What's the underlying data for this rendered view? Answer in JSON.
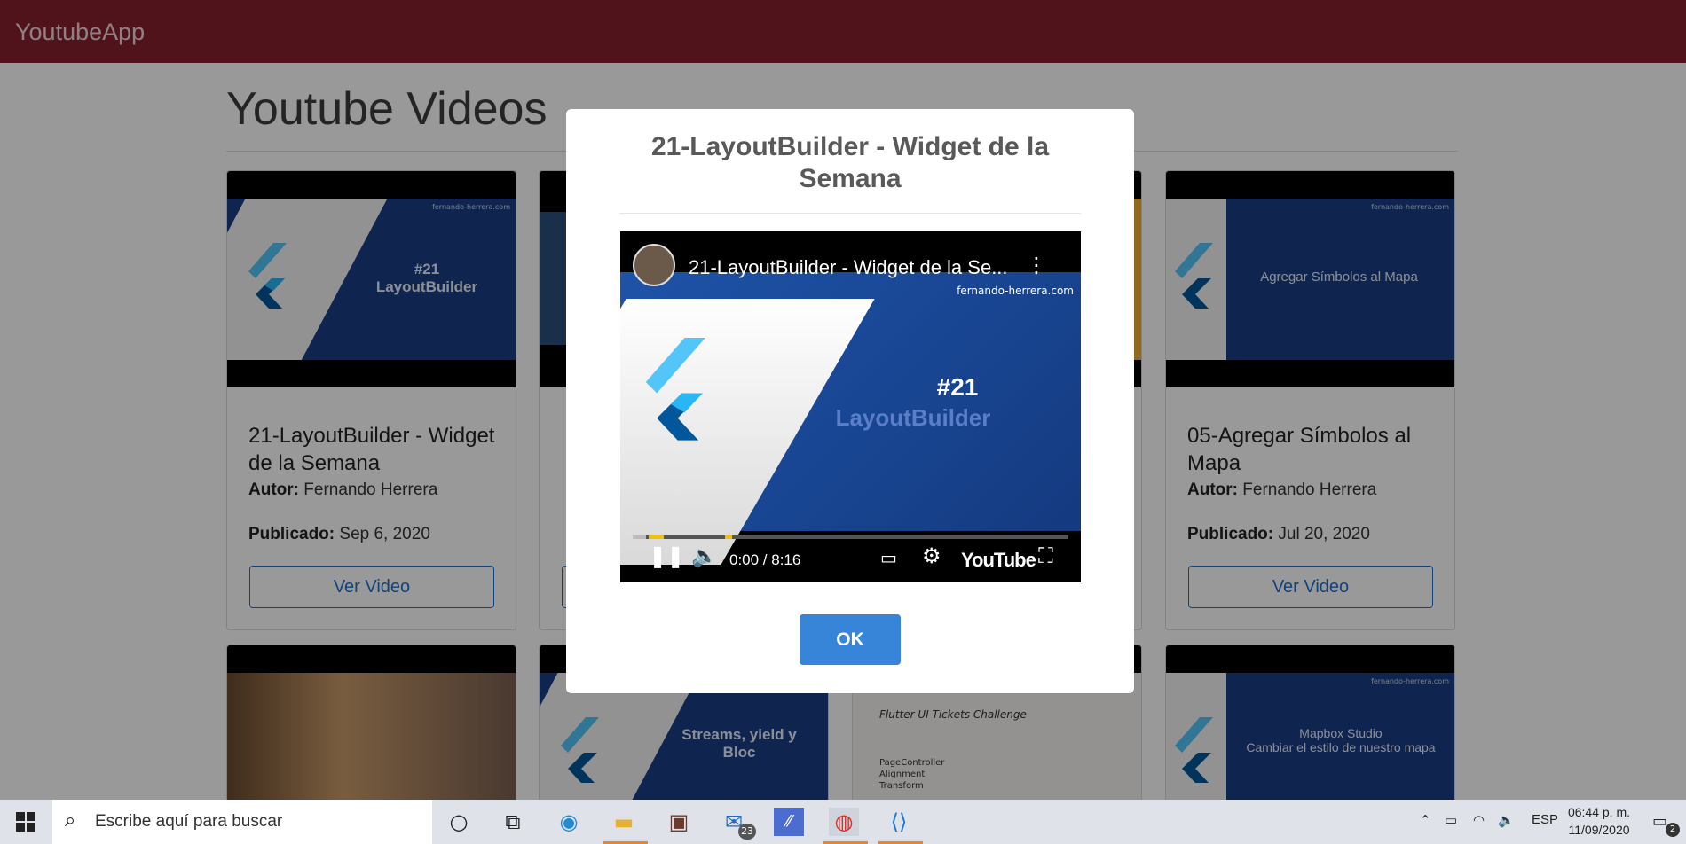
{
  "app": {
    "brand": "YoutubeApp"
  },
  "page": {
    "title": "Youtube Videos"
  },
  "cards": [
    {
      "slide_text": "#21\nLayoutBuilder",
      "slide_url": "fernando-herrera.com",
      "title": "21-LayoutBuilder - Widget de la Semana",
      "author_label": "Autor:",
      "author": "Fernando Herrera",
      "published_label": "Publicado:",
      "published": "Sep 6, 2020",
      "button": "Ver Video"
    },
    {
      "slide_text": "Agregar Símbolos al Mapa",
      "slide_url": "fernando-herrera.com",
      "title": "05-Agregar Símbolos al Mapa",
      "author_label": "Autor:",
      "author": "Fernando Herrera",
      "published_label": "Publicado:",
      "published": "Jul 20, 2020",
      "button": "Ver Video"
    }
  ],
  "row2": [
    {
      "slide_text": "Streams, yield y Bloc"
    },
    {
      "slide_text": "Flutter UI Tickets Challenge",
      "bullets": [
        "PageController",
        "Alignment",
        "Transform"
      ]
    },
    {
      "slide_text": "Mapbox Studio\nCambiar el estilo de nuestro mapa",
      "slide_url": "fernando-herrera.com"
    }
  ],
  "modal": {
    "title": "21-LayoutBuilder - Widget de la Semana",
    "video_title": "21-LayoutBuilder - Widget de la Se...",
    "video_url": "fernando-herrera.com",
    "video_big": "#21",
    "video_big2": "LayoutBuilder",
    "time": "0:00 / 8:16",
    "youtube_logo": "YouTube",
    "ok_label": "OK"
  },
  "taskbar": {
    "search_placeholder": "Escribe aquí para buscar",
    "mail_badge": "23",
    "lang": "ESP",
    "time": "06:44 p. m.",
    "date": "11/09/2020",
    "notif_badge": "2"
  }
}
